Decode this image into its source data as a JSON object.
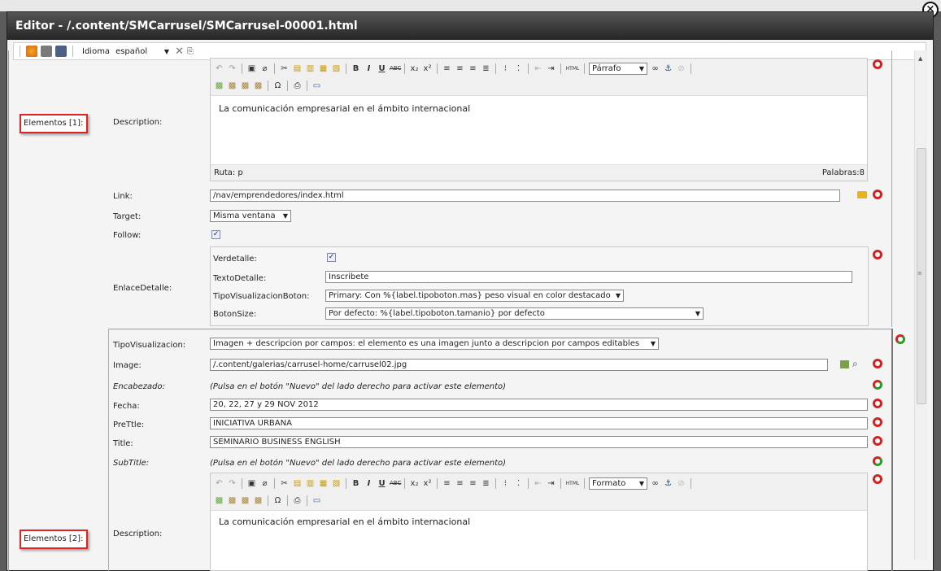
{
  "window": {
    "title": "Editor - /.content/SMCarrusel/SMCarrusel-00001.html",
    "close_icon": "close-icon"
  },
  "toolbar": {
    "idioma_label": "Idioma",
    "idioma_value": "español",
    "icons": [
      "refresh-icon",
      "delete-icon",
      "save-icon",
      "cancel-x-icon",
      "copy-icon"
    ]
  },
  "element1": {
    "tag": "Elementos [1]:",
    "description_label": "Description:",
    "editor_format": "Párrafo",
    "editor_text": "La comunicación empresarial en el ámbito internacional",
    "ruta": "Ruta: p",
    "palabras": "Palabras:8",
    "link_label": "Link:",
    "link_value": "/nav/emprendedores/index.html",
    "target_label": "Target:",
    "target_value": "Misma ventana",
    "follow_label": "Follow:",
    "follow_checked": true,
    "enlace_label": "EnlaceDetalle:",
    "verdetalle_label": "Verdetalle:",
    "verdetalle_checked": true,
    "textodetalle_label": "TextoDetalle:",
    "textodetalle_value": "Inscribete",
    "tipovisboton_label": "TipoVisualizacionBoton:",
    "tipovisboton_value": "Primary: Con %{label.tipoboton.mas} peso visual en color destacado",
    "botonsize_label": "BotonSize:",
    "botonsize_value": "Por defecto: %{label.tipoboton.tamanio} por defecto"
  },
  "element2": {
    "tag": "Elementos [2]:",
    "tipovis_label": "TipoVisualizacion:",
    "tipovis_value": "Imagen + descripcion por campos: el elemento es una imagen junto a descripcion por campos editables",
    "image_label": "Image:",
    "image_value": "/.content/galerias/carrusel-home/carrusel02.jpg",
    "encabezado_label": "Encabezado:",
    "inactive_hint": "(Pulsa en el botón \"Nuevo\" del lado derecho para activar este elemento)",
    "fecha_label": "Fecha:",
    "fecha_value": "20, 22, 27 y 29 NOV 2012",
    "pretitle_label": "PreTtle:",
    "pretitle_value": "INICIATIVA URBANA",
    "title_label": "Title:",
    "title_value": "SEMINARIO BUSINESS ENGLISH",
    "subtitle_label": "SubTitle:",
    "description_label": "Description:",
    "editor_format": "Formato",
    "editor_text": "La comunicación empresarial en el ámbito internacional"
  },
  "colors": {
    "title_bar": "#2b2b2b",
    "highlight_box": "#e12222",
    "action_red": "#d42222",
    "action_green": "#2a9a2a"
  }
}
